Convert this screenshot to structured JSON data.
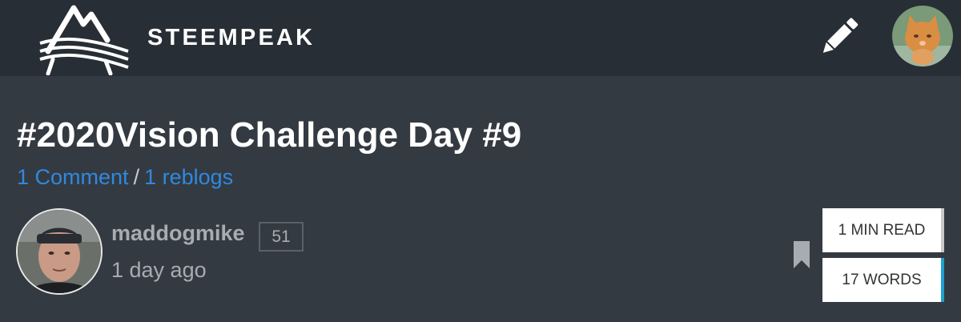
{
  "header": {
    "brand": "STEEMPEAK",
    "logo_icon": "steempeak-mountain-logo",
    "compose_icon": "pencil-icon",
    "user_avatar": "kitten-avatar"
  },
  "post": {
    "title": "#2020Vision Challenge Day #9",
    "comments": "1 Comment",
    "separator": "/",
    "reblogs": "1 reblogs",
    "author": "maddogmike",
    "reputation": "51",
    "time": "1 day ago",
    "read_time": "1 MIN READ",
    "word_count": "17 WORDS"
  },
  "colors": {
    "background": "#343a41",
    "topbar": "#272e35",
    "link": "#2f89e0",
    "accent": "#1ea1d0"
  }
}
